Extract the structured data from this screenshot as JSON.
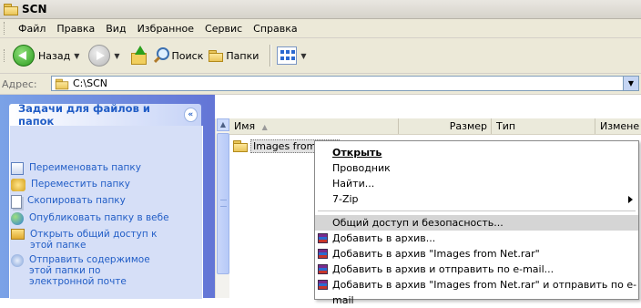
{
  "window": {
    "title": "SCN"
  },
  "menu": {
    "items": [
      "Файл",
      "Правка",
      "Вид",
      "Избранное",
      "Сервис",
      "Справка"
    ]
  },
  "toolbar": {
    "back_label": "Назад",
    "search_label": "Поиск",
    "folders_label": "Папки"
  },
  "address": {
    "label": "Адрес:",
    "value": "C:\\SCN"
  },
  "tasks": {
    "header": "Задачи для файлов и папок",
    "items": [
      {
        "label": "Переименовать папку",
        "icon": "rename-icon"
      },
      {
        "label": "Переместить папку",
        "icon": "move-icon"
      },
      {
        "label": "Скопировать папку",
        "icon": "copy-icon"
      },
      {
        "label": "Опубликовать папку в вебе",
        "icon": "globe-icon"
      },
      {
        "label": "Открыть общий доступ к этой папке",
        "icon": "share-icon"
      },
      {
        "label": "Отправить содержимое этой папки по электронной почте",
        "icon": "mail-icon"
      }
    ]
  },
  "columns": {
    "name": "Имя",
    "size": "Размер",
    "type": "Тип",
    "modified": "Измене"
  },
  "files": [
    {
      "name": "Images from Net"
    }
  ],
  "context_menu": {
    "open": "Открыть",
    "explorer": "Проводник",
    "find": "Найти...",
    "sevenzip": "7-Zip",
    "sharing": "Общий доступ и безопасность...",
    "rar_add": "Добавить в архив...",
    "rar_add_named": "Добавить в архив \"Images from Net.rar\"",
    "rar_add_email": "Добавить в архив и отправить по e-mail...",
    "rar_add_named_email": "Добавить в архив \"Images from Net.rar\" и отправить по e-mail"
  }
}
